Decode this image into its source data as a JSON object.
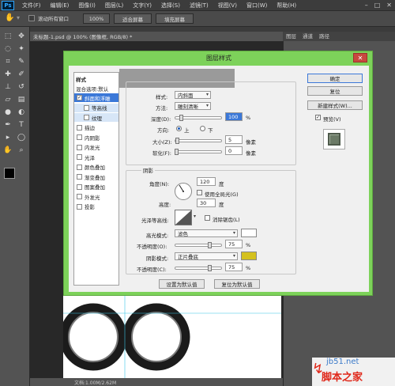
{
  "menubar": {
    "logo": "Ps",
    "items": [
      "文件(F)",
      "编辑(E)",
      "图像(I)",
      "图层(L)",
      "文字(Y)",
      "选择(S)",
      "滤镜(T)",
      "视图(V)",
      "窗口(W)",
      "帮助(H)"
    ],
    "controls": [
      "–",
      "□",
      "✕"
    ]
  },
  "options": {
    "scroll_all": "滚动所有窗口",
    "zoom_pct": "100%",
    "fit_screen": "适合屏幕",
    "fill_screen": "填充屏幕"
  },
  "document": {
    "tab_title": "未标题-1.psd @ 100% (图像框, RGB/8) *",
    "status": "文档:1.00M/2.62M"
  },
  "right_panel": {
    "tabs": [
      "图层",
      "通道",
      "路径"
    ]
  },
  "watermark": {
    "url": "jb51.net",
    "name": "脚本之家"
  },
  "dialog": {
    "title": "图层样式",
    "close": "✕",
    "styles_header": "样式",
    "blend_label": "混合选项:默认",
    "styles": [
      {
        "label": "斜面和浮雕",
        "checked": true,
        "selected": true,
        "sub": false
      },
      {
        "label": "等高线",
        "checked": false,
        "selected": false,
        "sub": true
      },
      {
        "label": "纹理",
        "checked": false,
        "selected": false,
        "sub": true
      },
      {
        "label": "描边",
        "checked": false,
        "selected": false,
        "sub": false
      },
      {
        "label": "内阴影",
        "checked": false,
        "selected": false,
        "sub": false
      },
      {
        "label": "内发光",
        "checked": false,
        "selected": false,
        "sub": false
      },
      {
        "label": "光泽",
        "checked": false,
        "selected": false,
        "sub": false
      },
      {
        "label": "颜色叠加",
        "checked": false,
        "selected": false,
        "sub": false
      },
      {
        "label": "渐变叠加",
        "checked": false,
        "selected": false,
        "sub": false
      },
      {
        "label": "图案叠加",
        "checked": false,
        "selected": false,
        "sub": false
      },
      {
        "label": "外发光",
        "checked": false,
        "selected": false,
        "sub": false
      },
      {
        "label": "投影",
        "checked": false,
        "selected": false,
        "sub": false
      }
    ],
    "structure": {
      "style_label": "样式:",
      "style_value": "内斜面",
      "method_label": "方法:",
      "method_value": "雕刻清晰",
      "depth_label": "深度(D):",
      "depth_value": "100",
      "depth_unit": "%",
      "direction_label": "方向:",
      "dir_up": "上",
      "dir_down": "下",
      "direction_selected": "上",
      "size_label": "大小(Z):",
      "size_value": "5",
      "size_unit": "像素",
      "soften_label": "软化(F):",
      "soften_value": "0",
      "soften_unit": "像素",
      "depth_slider": 0.1,
      "size_slider": 0.02,
      "soften_slider": 0.0
    },
    "shading": {
      "header": "阴影",
      "angle_label": "角度(N):",
      "angle_value": "120",
      "angle_unit": "度",
      "global_light": "使用全局光(G)",
      "altitude_label": "高度:",
      "altitude_value": "30",
      "altitude_unit": "度",
      "gloss_label": "光泽等高线:",
      "antialias": "消除锯齿(L)",
      "hl_mode_label": "高光模式:",
      "hl_mode_value": "滤色",
      "hl_opacity_label": "不透明度(O):",
      "hl_opacity_value": "75",
      "hl_opacity_unit": "%",
      "sh_mode_label": "阴影模式:",
      "sh_mode_value": "正片叠底",
      "sh_opacity_label": "不透明度(C):",
      "sh_opacity_value": "75",
      "sh_opacity_unit": "%",
      "hl_color": "#ffffff",
      "sh_color": "#d4c11e",
      "hl_opacity_slider": 0.75,
      "sh_opacity_slider": 0.75
    },
    "buttons": {
      "set_default": "设置为默认值",
      "reset_default": "复位为默认值",
      "ok": "确定",
      "reset": "复位",
      "new_style": "新建样式(W)...",
      "preview": "预览(V)"
    }
  }
}
